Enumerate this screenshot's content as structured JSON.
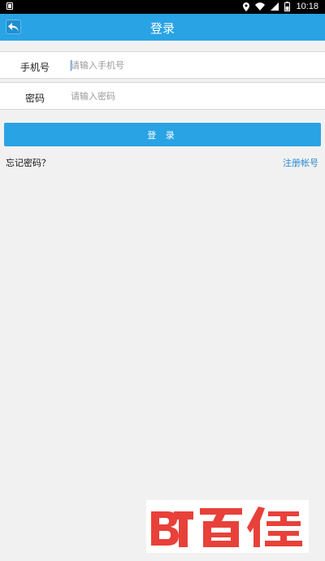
{
  "status_bar": {
    "time": "10:18"
  },
  "header": {
    "title": "登录"
  },
  "form": {
    "phone": {
      "label": "手机号",
      "placeholder": "请输入手机号"
    },
    "password": {
      "label": "密码",
      "placeholder": "请输入密码"
    },
    "login_label": "登 录"
  },
  "links": {
    "forgot": "忘记密码？",
    "register": "注册帐号"
  },
  "watermark": {
    "text": "BT百佳"
  },
  "colors": {
    "primary": "#29a3e4",
    "link": "#2b8ad1",
    "watermark_red": "#e8413a"
  }
}
